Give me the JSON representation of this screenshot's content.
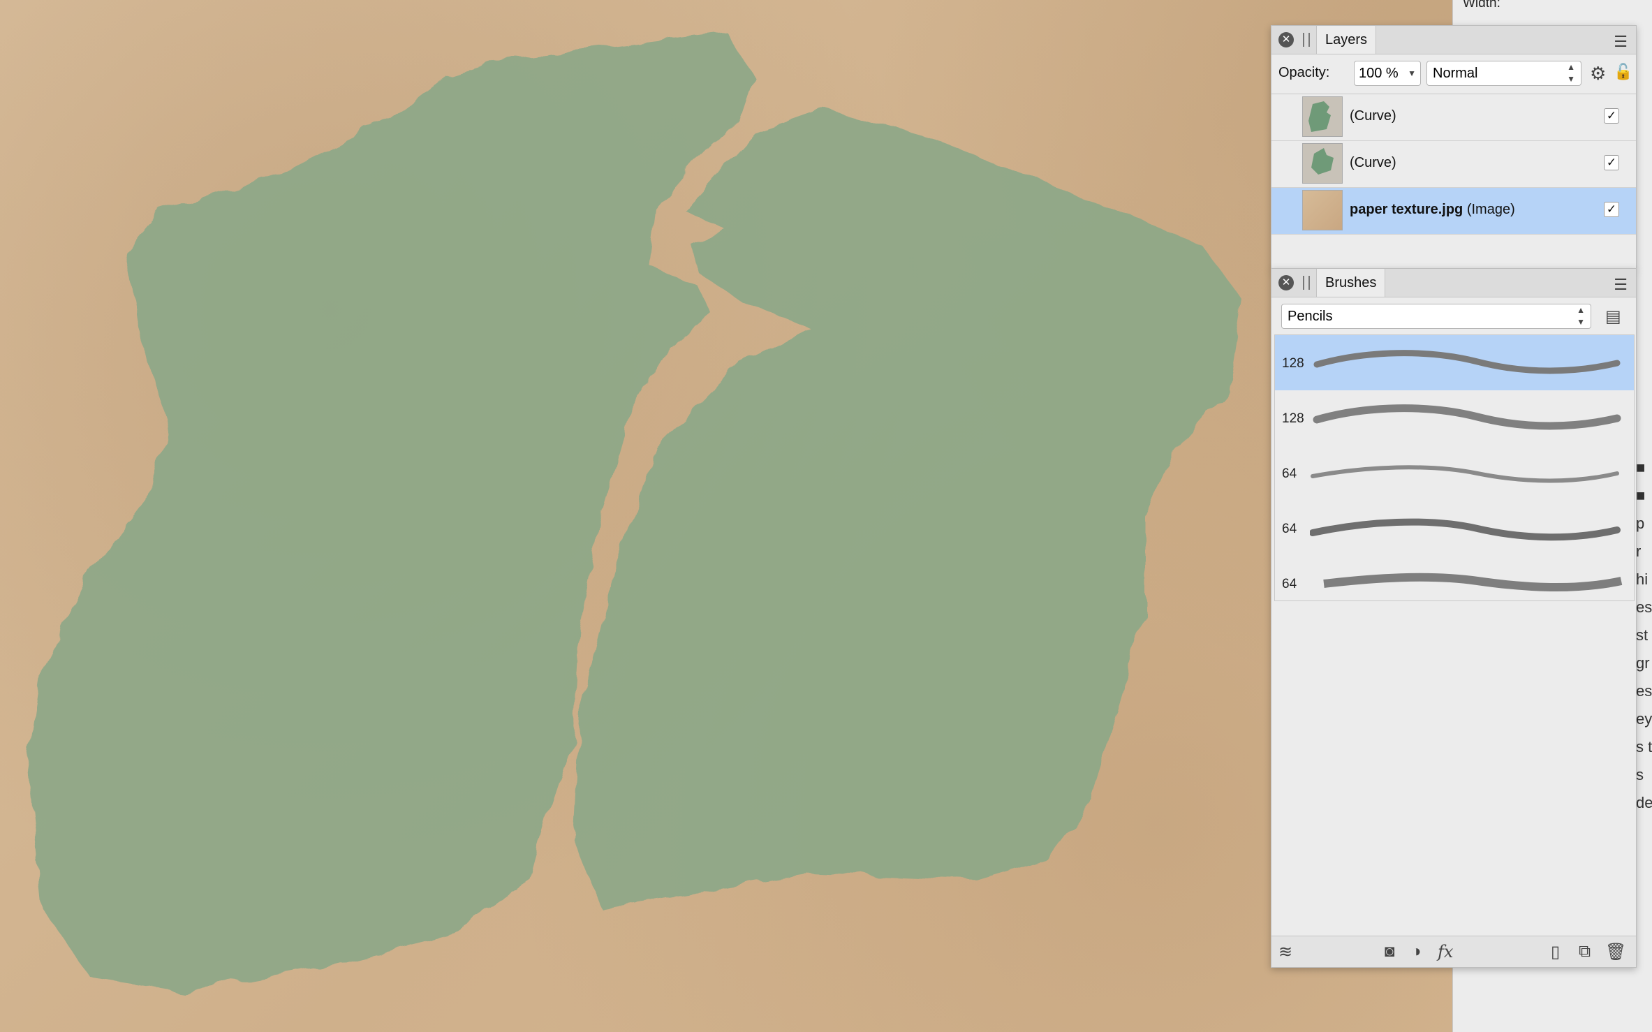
{
  "layers_panel": {
    "tab": "Layers",
    "opacity_label": "Opacity:",
    "opacity_value": "100 %",
    "blend_mode": "Normal",
    "layers": [
      {
        "name": "(Curve)",
        "suffix": "",
        "visible_check": "✓",
        "selected": false
      },
      {
        "name": "(Curve)",
        "suffix": "",
        "visible_check": "✓",
        "selected": false
      },
      {
        "name": "paper texture.jpg",
        "suffix": "(Image)",
        "visible_check": "✓",
        "selected": true
      }
    ]
  },
  "brushes_panel": {
    "tab": "Brushes",
    "category": "Pencils",
    "brushes": [
      {
        "size": "128",
        "selected": true
      },
      {
        "size": "128",
        "selected": false
      },
      {
        "size": "64",
        "selected": false
      },
      {
        "size": "64",
        "selected": false
      },
      {
        "size": "64",
        "selected": false
      }
    ]
  },
  "background_panel": {
    "width_label": "Width:",
    "side_glyphs": [
      "■",
      "■",
      "p",
      "r",
      "hi",
      "es",
      "st",
      "gr",
      "es",
      "ey",
      "s t",
      "s",
      "de"
    ]
  },
  "icons": {
    "close": "close-icon",
    "menu": "menu-icon",
    "gear": "gear-icon",
    "lock": "lock-icon",
    "list_view": "list-view-icon",
    "layers": "layers-icon",
    "mask": "mask-icon",
    "adjustment": "adjustment-icon",
    "fx": "fx-icon",
    "new_layer": "new-layer-icon",
    "duplicate": "duplicate-icon",
    "trash": "trash-icon"
  },
  "colors": {
    "paint": "#8ea888",
    "paper": "#d6b892",
    "selection": "#b6d3f7"
  }
}
